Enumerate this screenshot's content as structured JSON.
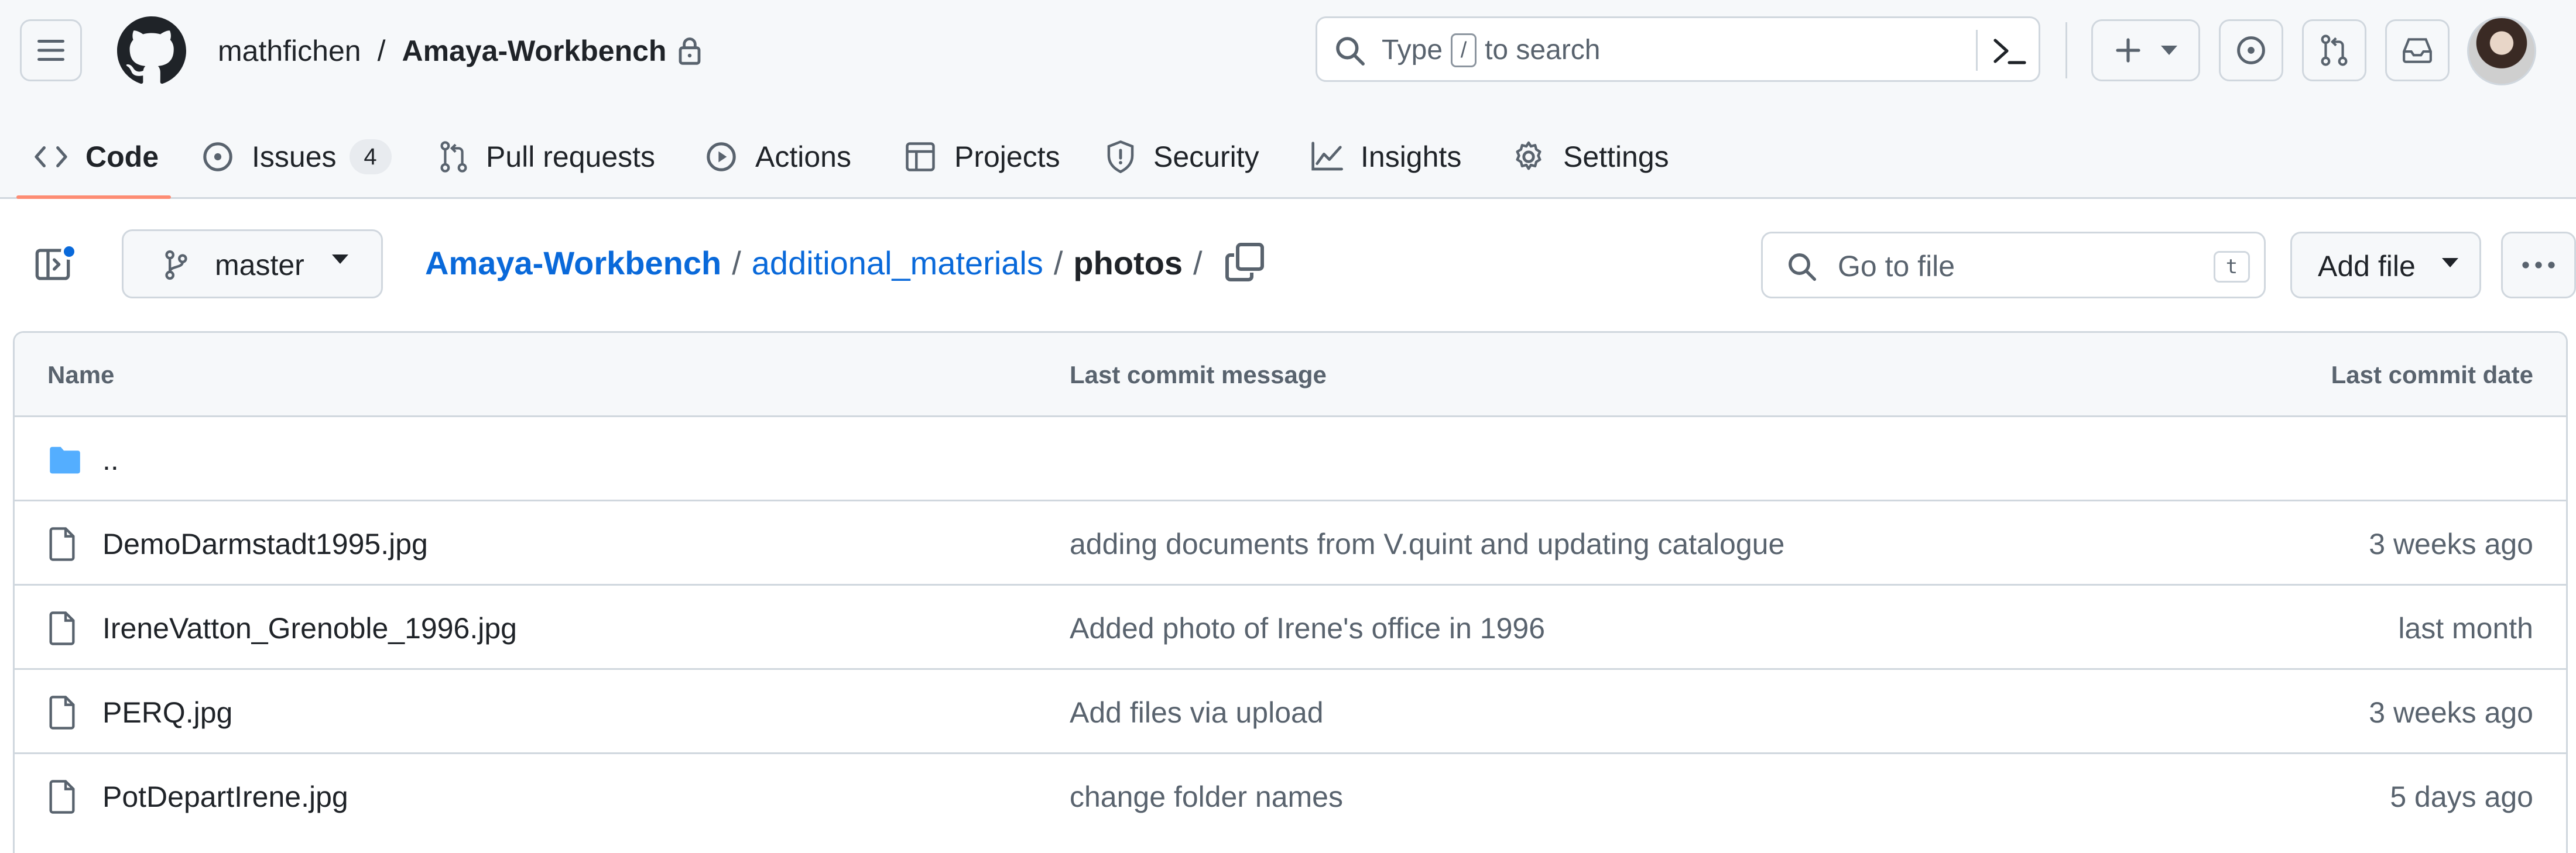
{
  "header": {
    "owner": "mathfichen",
    "separator": "/",
    "repo": "Amaya-Workbench",
    "search": {
      "prefix": "Type",
      "key": "/",
      "suffix": "to search"
    }
  },
  "nav": {
    "tabs": [
      {
        "label": "Code",
        "selected": true
      },
      {
        "label": "Issues",
        "count": "4"
      },
      {
        "label": "Pull requests"
      },
      {
        "label": "Actions"
      },
      {
        "label": "Projects"
      },
      {
        "label": "Security"
      },
      {
        "label": "Insights"
      },
      {
        "label": "Settings"
      }
    ]
  },
  "file_bar": {
    "branch": "master",
    "breadcrumb": {
      "root": "Amaya-Workbench",
      "sep": "/",
      "middle": "additional_materials",
      "current": "photos",
      "trailing": "/"
    },
    "goto": {
      "placeholder": "Go to file",
      "shortcut": "t"
    },
    "add_file": "Add file"
  },
  "table": {
    "headers": {
      "name": "Name",
      "message": "Last commit message",
      "date": "Last commit date"
    },
    "parent": "..",
    "rows": [
      {
        "name": "DemoDarmstadt1995.jpg",
        "message": "adding documents from V.quint and updating catalogue",
        "date": "3 weeks ago"
      },
      {
        "name": "IreneVatton_Grenoble_1996.jpg",
        "message": "Added photo of Irene's office in 1996",
        "date": "last month"
      },
      {
        "name": "PERQ.jpg",
        "message": "Add files via upload",
        "date": "3 weeks ago"
      },
      {
        "name": "PotDepartIrene.jpg",
        "message": "change folder names",
        "date": "5 days ago"
      }
    ]
  },
  "colors": {
    "accent": "#0969da",
    "tab_underline": "#fd8c73",
    "folder": "#54aeff",
    "border": "#d0d7de",
    "muted": "#59636e"
  },
  "icons": [
    "hamburger-icon",
    "github-logo",
    "lock-icon",
    "search-icon",
    "terminal-icon",
    "plus-icon",
    "issue-icon",
    "pull-request-icon",
    "inbox-icon",
    "code-icon",
    "play-icon",
    "table-icon",
    "shield-icon",
    "graph-icon",
    "gear-icon",
    "sidebar-icon",
    "branch-icon",
    "copy-icon",
    "kebab-icon",
    "folder-icon",
    "file-icon"
  ]
}
